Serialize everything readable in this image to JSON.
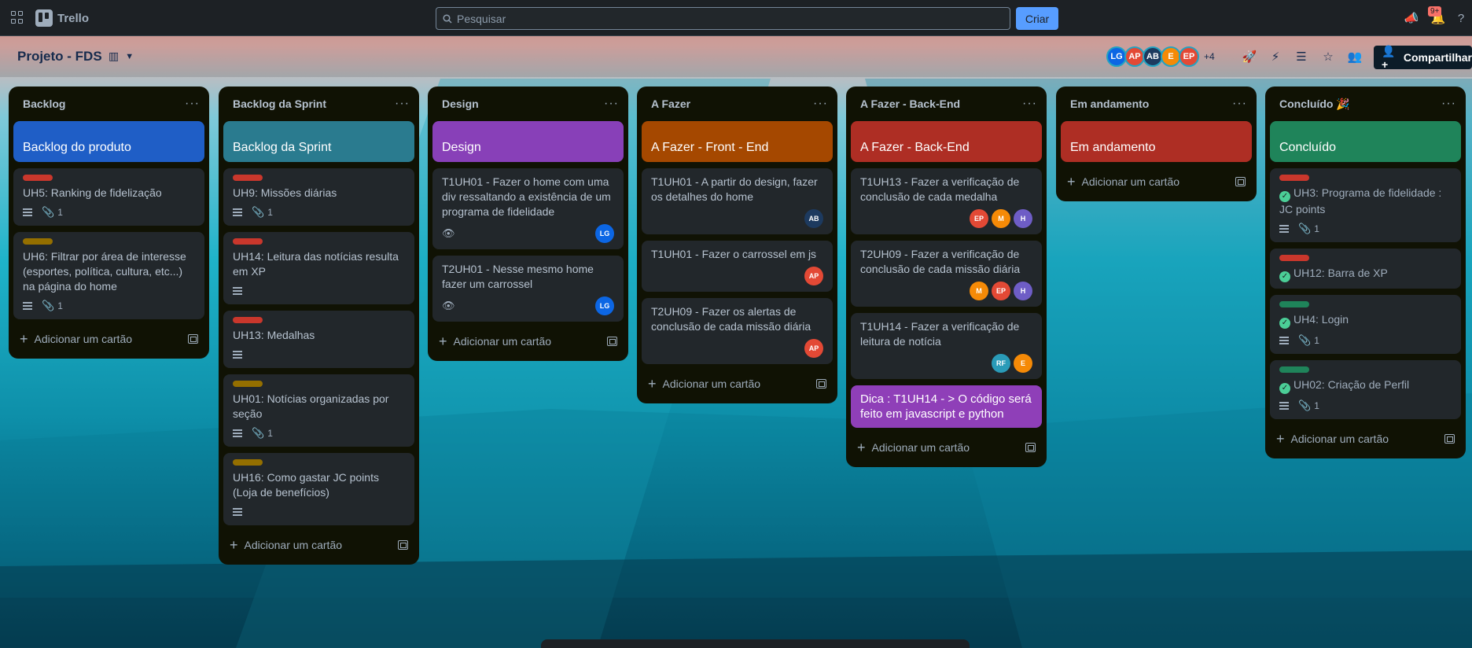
{
  "topbar": {
    "logo_text": "Trello",
    "search_placeholder": "Pesquisar",
    "create_label": "Criar",
    "notif_count": "9+"
  },
  "board": {
    "title": "Projeto - FDS",
    "members": [
      {
        "initials": "LG",
        "color": "#0c66e4"
      },
      {
        "initials": "AP",
        "color": "#e34935"
      },
      {
        "initials": "AB",
        "color": "#1d3a5f"
      },
      {
        "initials": "E",
        "color": "#f58a07"
      },
      {
        "initials": "EP",
        "color": "#e34935"
      }
    ],
    "more_members": "+4",
    "share_label": "Compartilhar"
  },
  "add_card_label": "Adicionar um cartão",
  "lists": [
    {
      "title": "Backlog",
      "color_card": {
        "text": "Backlog do produto",
        "color": "#1f5ec6"
      },
      "cards": [
        {
          "label": "#c9372c",
          "title": "UH5: Ranking de fidelização",
          "desc": true,
          "attach": "1"
        },
        {
          "label": "#946f00",
          "title": "UH6: Filtrar por área de interesse (esportes, política, cultura, etc...) na página do home",
          "desc": true,
          "attach": "1"
        }
      ]
    },
    {
      "title": "Backlog da Sprint",
      "color_card": {
        "text": "Backlog da Sprint",
        "color": "#2a7b8f"
      },
      "cards": [
        {
          "label": "#c9372c",
          "title": "UH9: Missões diárias",
          "desc": true,
          "attach": "1"
        },
        {
          "label": "#c9372c",
          "title": "UH14: Leitura das notícias resulta em XP",
          "desc": true
        },
        {
          "label": "#c9372c",
          "title": "UH13: Medalhas",
          "desc": true
        },
        {
          "label": "#946f00",
          "title": "UH01: Notícias organizadas por seção",
          "desc": true,
          "attach": "1"
        },
        {
          "label": "#946f00",
          "title": "UH16: Como gastar JC points (Loja de benefícios)",
          "desc": true
        }
      ]
    },
    {
      "title": "Design",
      "color_card": {
        "text": "Design",
        "color": "#8840b8"
      },
      "cards": [
        {
          "title": "T1UH01 - Fazer o home com uma div ressaltando a existência de um programa de fidelidade",
          "watch": true,
          "avatars": [
            {
              "initials": "LG",
              "color": "#0c66e4"
            }
          ]
        },
        {
          "title": "T2UH01 - Nesse mesmo home fazer um carrossel",
          "watch": true,
          "avatars": [
            {
              "initials": "LG",
              "color": "#0c66e4"
            }
          ]
        }
      ]
    },
    {
      "title": "A Fazer",
      "color_card": {
        "text": "A Fazer - Front - End",
        "color": "#a54800"
      },
      "cards": [
        {
          "title": "T1UH01 - A partir do design, fazer os detalhes do home",
          "avatars": [
            {
              "initials": "AB",
              "color": "#1d3a5f"
            }
          ]
        },
        {
          "title": "T1UH01 - Fazer o carrossel em js",
          "avatars": [
            {
              "initials": "AP",
              "color": "#e34935"
            }
          ]
        },
        {
          "title": "T2UH09 - Fazer os alertas de conclusão de cada missão diária",
          "avatars": [
            {
              "initials": "AP",
              "color": "#e34935"
            }
          ]
        }
      ]
    },
    {
      "title": "A Fazer - Back-End",
      "color_card": {
        "text": "A Fazer - Back-End",
        "color": "#ae2e24"
      },
      "cards": [
        {
          "title": "T1UH13 - Fazer a verificação de conclusão de cada medalha",
          "avatars": [
            {
              "initials": "EP",
              "color": "#e34935"
            },
            {
              "initials": "M",
              "color": "#f58a07"
            },
            {
              "initials": "H",
              "color": "#6e5dc6"
            }
          ]
        },
        {
          "title": "T2UH09 - Fazer a verificação de conclusão de cada missão diária",
          "avatars": [
            {
              "initials": "M",
              "color": "#f58a07"
            },
            {
              "initials": "EP",
              "color": "#e34935"
            },
            {
              "initials": "H",
              "color": "#6e5dc6"
            }
          ]
        },
        {
          "title": "T1UH14 - Fazer a verificação de leitura de notícia",
          "avatars": [
            {
              "initials": "RF",
              "color": "#2a9bb8"
            },
            {
              "initials": "E",
              "color": "#f58a07"
            }
          ]
        }
      ],
      "note_card": {
        "text": "Dica : T1UH14 - > O código será feito em javascript e python",
        "color": "#8f3fb8"
      }
    },
    {
      "title": "Em andamento",
      "color_card": {
        "text": "Em andamento",
        "color": "#ae2e24"
      },
      "cards": []
    },
    {
      "title": "Concluído 🎉",
      "color_card": {
        "text": "Concluído",
        "color": "#1f845a"
      },
      "cards": [
        {
          "label": "#c9372c",
          "title": "UH3: Programa de fidelidade : JC points",
          "done": true,
          "desc": true,
          "attach": "1"
        },
        {
          "label": "#c9372c",
          "title": "UH12: Barra de XP",
          "done": true
        },
        {
          "label": "#1f845a",
          "title": "UH4: Login",
          "done": true,
          "desc": true,
          "attach": "1"
        },
        {
          "label": "#1f845a",
          "title": "UH02: Criação de Perfil",
          "done": true,
          "desc": true,
          "attach": "1"
        }
      ]
    }
  ]
}
